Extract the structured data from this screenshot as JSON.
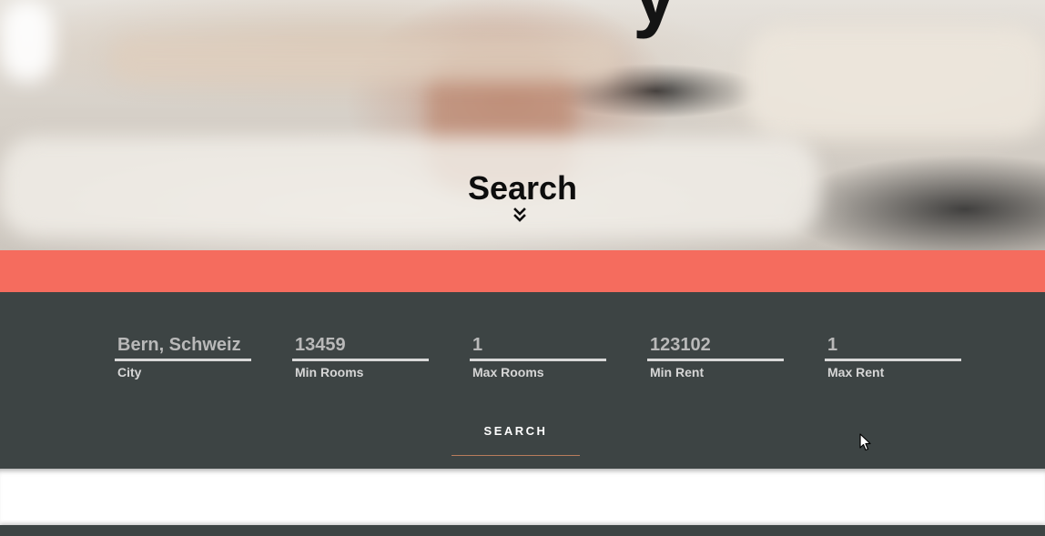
{
  "hero": {
    "headline_fragment": "y",
    "title": "Search"
  },
  "search_form": {
    "fields": [
      {
        "label": "City",
        "value": "Bern, Schweiz"
      },
      {
        "label": "Min Rooms",
        "value": "13459"
      },
      {
        "label": "Max Rooms",
        "value": "1"
      },
      {
        "label": "Min Rent",
        "value": "123102"
      },
      {
        "label": "Max Rent",
        "value": "1"
      }
    ],
    "submit_label": "SEARCH"
  },
  "colors": {
    "accent_band": "#f56c5e",
    "panel_background": "#3d4444",
    "button_underline": "#b87c5c"
  },
  "icons": {
    "scroll_down": "chevron-double-down-icon",
    "pointer": "mouse-cursor-icon"
  }
}
